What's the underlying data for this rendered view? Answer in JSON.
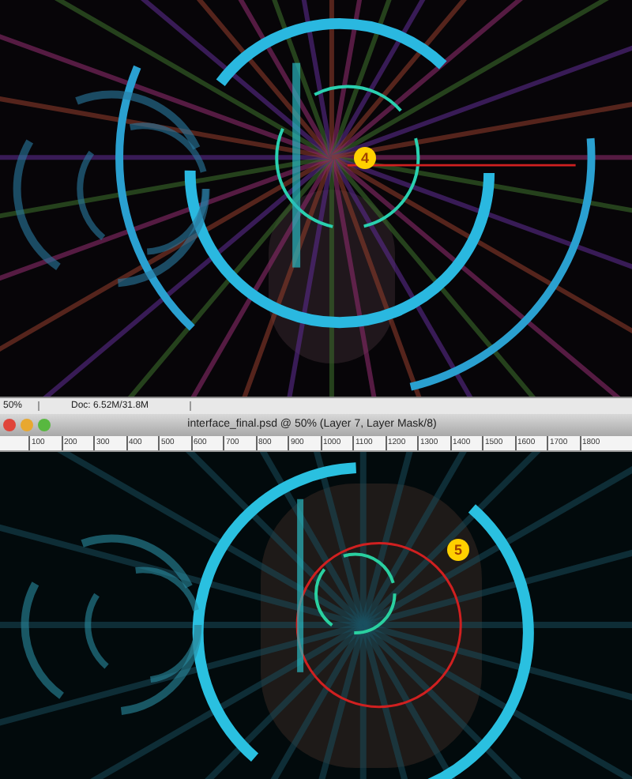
{
  "top_canvas": {
    "badge": "4"
  },
  "status_bar": {
    "zoom": "50%",
    "doc_info": "Doc: 6.52M/31.8M"
  },
  "document_window": {
    "title": "interface_final.psd @ 50% (Layer 7, Layer Mask/8)",
    "ruler_labels": [
      "100",
      "200",
      "300",
      "400",
      "500",
      "600",
      "700",
      "800",
      "900",
      "1000",
      "1100",
      "1200",
      "1300",
      "1400",
      "1500",
      "1600",
      "1700",
      "1800"
    ],
    "badge": "5"
  }
}
